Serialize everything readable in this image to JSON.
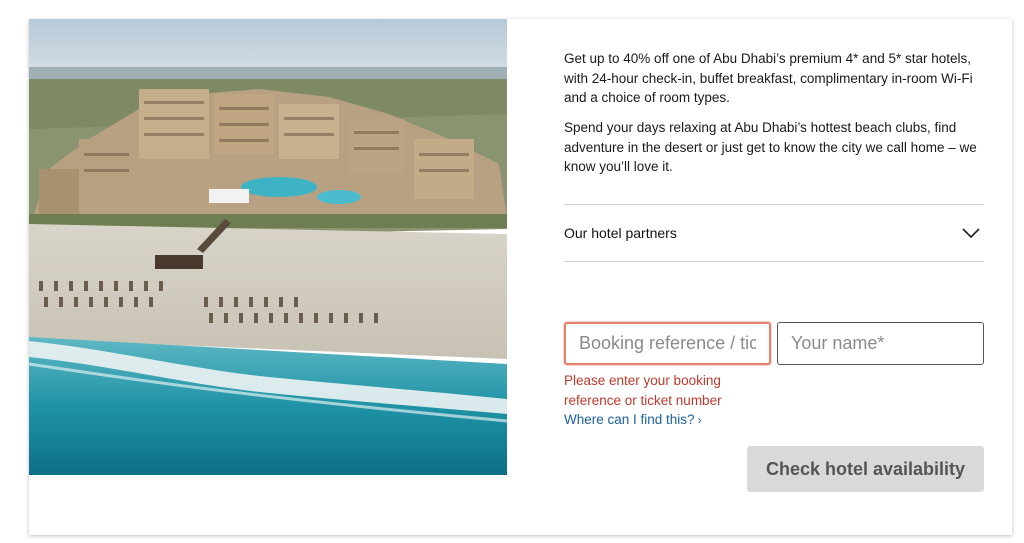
{
  "offer": {
    "paragraph1": "Get up to 40% off one of Abu Dhabi’s premium 4* and 5* star hotels, with 24-hour check-in, buffet breakfast, complimentary in-room Wi-Fi and a choice of room types.",
    "paragraph2": "Spend your days relaxing at Abu Dhabi’s hottest beach clubs, find adventure in the desert or just get to know the city we call home – we know you’ll love it."
  },
  "accordion": {
    "label": "Our hotel partners",
    "icon": "chevron-down-icon"
  },
  "form": {
    "booking_placeholder": "Booking reference / ticket number*",
    "name_placeholder": "Your name*",
    "error": "Please enter your booking reference or ticket number",
    "help_link": "Where can I find this?",
    "help_arrow": "›",
    "submit_label": "Check hotel availability"
  },
  "colors": {
    "error": "#c0392b",
    "link": "#1b5f9e",
    "button_bg": "#d9d9d9",
    "error_border": "#e8806f"
  }
}
